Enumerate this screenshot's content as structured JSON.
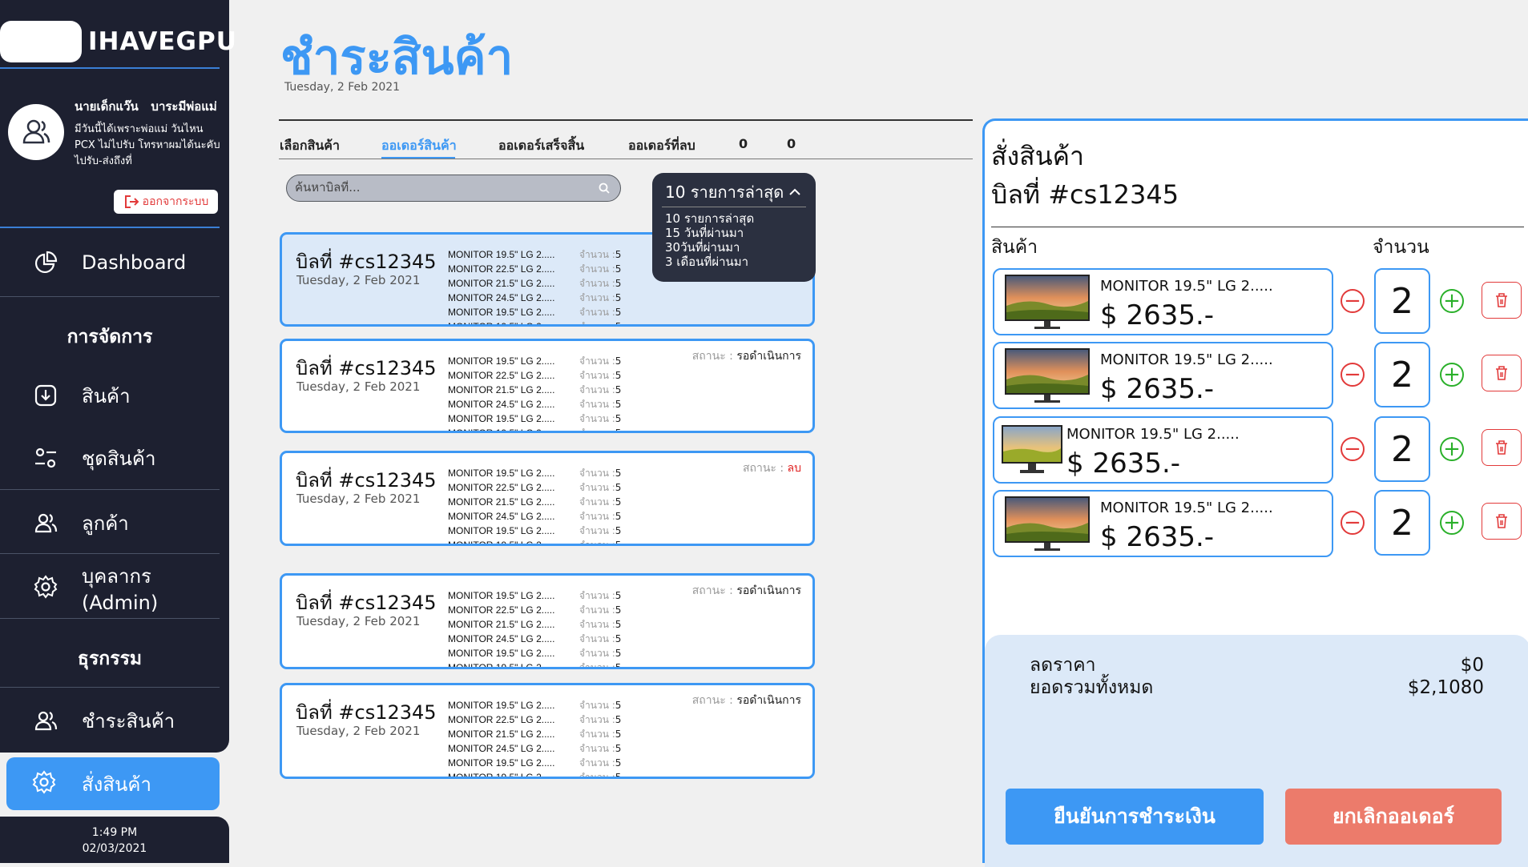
{
  "brand": "IHAVEGPU",
  "user": {
    "name": "นายเด็กแว๊น   บาระมีพ่อแม่",
    "bio": "มีวันนี้ได้เพราะพ่อแม่ วันไหน PCX ไม่ไปรับ โทรหาผมได้นะคับไปรับ-ส่งถึงที่",
    "logout_label": "ออกจากระบบ"
  },
  "nav": {
    "dashboard": "Dashboard",
    "section_manage": "การจัดการ",
    "products": "สินค้า",
    "product_sets": "ชุดสินค้า",
    "customers": "ลูกค้า",
    "staff": "บุคลากร (Admin)",
    "section_transactions": "ธุรกรรม",
    "payment": "ชำระสินค้า",
    "order": "สั่งสินค้า"
  },
  "clock": {
    "time": "1:49 PM",
    "date": "02/03/2021"
  },
  "page": {
    "title": "ชำระสินค้า",
    "date": "Tuesday, 2 Feb 2021"
  },
  "tabs": [
    "เลือกสินค้า",
    "ออเดอร์สินค้า",
    "ออเดอร์เสร็จสิ้น",
    "ออเดอร์ที่ลบ",
    "0",
    "0"
  ],
  "search": {
    "placeholder": "ค้นหาบิลที่..."
  },
  "filter": {
    "selected": "10 รายการล่าสุด",
    "options": [
      "10 รายการล่าสุด",
      "15 วันที่ผ่านมา",
      "30วันที่ผ่านมา",
      "3 เดือนที่ผ่านมา"
    ]
  },
  "bills": [
    {
      "no": "บิลที่ #cs12345",
      "date": "Tuesday, 2 Feb 2021",
      "status_label": "",
      "status_value": "",
      "items": [
        "MONITOR 19.5\" LG 2.....",
        "MONITOR 22.5\" LG 2.....",
        "MONITOR 21.5\" LG 2.....",
        "MONITOR 24.5\" LG 2.....",
        "MONITOR 19.5\" LG 2.....",
        "MONITOR 19.5\" LG 2....."
      ],
      "qty_label": "จำนวน :",
      "qtys": [
        "5",
        "5",
        "5",
        "5",
        "5",
        "5"
      ]
    },
    {
      "no": "บิลที่ #cs12345",
      "date": "Tuesday, 2 Feb 2021",
      "status_label": "สถานะ :",
      "status_value": "รอดำเนินการ",
      "items": [
        "MONITOR 19.5\" LG 2.....",
        "MONITOR 22.5\" LG 2.....",
        "MONITOR 21.5\" LG 2.....",
        "MONITOR 24.5\" LG 2.....",
        "MONITOR 19.5\" LG 2.....",
        "MONITOR 19.5\" LG 2....."
      ],
      "qty_label": "จำนวน :",
      "qtys": [
        "5",
        "5",
        "5",
        "5",
        "5",
        "5"
      ]
    },
    {
      "no": "บิลที่ #cs12345",
      "date": "Tuesday, 2 Feb 2021",
      "status_label": "สถานะ :",
      "status_value": "ลบ",
      "items": [
        "MONITOR 19.5\" LG 2.....",
        "MONITOR 22.5\" LG 2.....",
        "MONITOR 21.5\" LG 2.....",
        "MONITOR 24.5\" LG 2.....",
        "MONITOR 19.5\" LG 2.....",
        "MONITOR 19.5\" LG 2....."
      ],
      "qty_label": "จำนวน :",
      "qtys": [
        "5",
        "5",
        "5",
        "5",
        "5",
        "5"
      ]
    },
    {
      "no": "บิลที่ #cs12345",
      "date": "Tuesday, 2 Feb 2021",
      "status_label": "สถานะ :",
      "status_value": "รอดำเนินการ",
      "items": [
        "MONITOR 19.5\" LG 2.....",
        "MONITOR 22.5\" LG 2.....",
        "MONITOR 21.5\" LG 2.....",
        "MONITOR 24.5\" LG 2.....",
        "MONITOR 19.5\" LG 2.....",
        "MONITOR 19.5\" LG 2....."
      ],
      "qty_label": "จำนวน :",
      "qtys": [
        "5",
        "5",
        "5",
        "5",
        "5",
        "5"
      ]
    },
    {
      "no": "บิลที่ #cs12345",
      "date": "Tuesday, 2 Feb 2021",
      "status_label": "สถานะ :",
      "status_value": "รอดำเนินการ",
      "items": [
        "MONITOR 19.5\" LG 2.....",
        "MONITOR 22.5\" LG 2.....",
        "MONITOR 21.5\" LG 2.....",
        "MONITOR 24.5\" LG 2.....",
        "MONITOR 19.5\" LG 2.....",
        "MONITOR 19.5\" LG 2....."
      ],
      "qty_label": "จำนวน :",
      "qtys": [
        "5",
        "5",
        "5",
        "5",
        "5",
        "5"
      ]
    }
  ],
  "order_panel": {
    "title": "สั่งสินค้า",
    "bill_no": "บิลที่ #cs12345",
    "col_product": "สินค้า",
    "col_qty": "จำนวน",
    "items": [
      {
        "name": "MONITOR 19.5\" LG 2.....",
        "price": "$ 2635.-",
        "qty": "2"
      },
      {
        "name": "MONITOR 19.5\" LG 2.....",
        "price": "$ 2635.-",
        "qty": "2"
      },
      {
        "name": "MONITOR 19.5\" LG 2.....",
        "price": "$ 2635.-",
        "qty": "2"
      },
      {
        "name": "MONITOR 19.5\" LG 2.....",
        "price": "$ 2635.-",
        "qty": "2"
      }
    ],
    "discount_label": "ลดราคา",
    "discount_value": "$0",
    "total_label": "ยอดรวมทั้งหมด",
    "total_value": "$2,1080",
    "confirm_label": "ยืนยันการชำระเงิน",
    "cancel_label": "ยกเลิกออเดอร์"
  },
  "colors": {
    "accent": "#3d98f4",
    "sidebar": "#1d2030",
    "danger": "#e23a3a",
    "success": "#2ab02a",
    "cancel": "#ec7b6b",
    "panel_bg": "#dce9f8"
  }
}
